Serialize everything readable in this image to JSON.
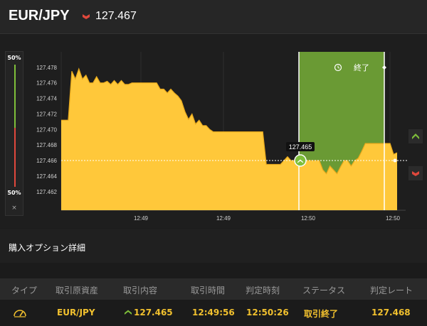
{
  "header": {
    "pair": "EUR/JPY",
    "rate": "127.467",
    "direction_icon": "down-arrow-icon",
    "down_color": "#e0483c"
  },
  "ratio": {
    "top": "50%",
    "bottom": "50%",
    "close": "×"
  },
  "chart_data": {
    "type": "area",
    "ylim": [
      127.4596,
      127.48
    ],
    "y_ticks": [
      127.478,
      127.476,
      127.474,
      127.472,
      127.47,
      127.468,
      127.466,
      127.464,
      127.462
    ],
    "y_tick_labels": [
      "127.478",
      "127.476",
      "127.474",
      "127.472",
      "127.470",
      "127.468",
      "127.466",
      "127.464",
      "127.462"
    ],
    "x_ticks": [
      "12:49",
      "12:49",
      "12:50",
      "12:50"
    ],
    "series": [
      {
        "values": [
          127.4712,
          127.4712,
          127.4712,
          127.4775,
          127.4765,
          127.4778,
          127.4765,
          127.477,
          127.476,
          127.476,
          127.4768,
          127.476,
          127.476,
          127.4762,
          127.4758,
          127.4763,
          127.4758,
          127.4763,
          127.4758,
          127.4758,
          127.476,
          127.476,
          127.476,
          127.476,
          127.476,
          127.476,
          127.476,
          127.476,
          127.4752,
          127.4752,
          127.4747,
          127.4752,
          127.4747,
          127.4743,
          127.4737,
          127.4723,
          127.4713,
          127.472,
          127.4707,
          127.4712,
          127.4705,
          127.4705,
          127.47,
          127.4697,
          127.4697,
          127.4697,
          127.4697,
          127.4697,
          127.4697,
          127.4697,
          127.4697,
          127.4697,
          127.4697,
          127.4697,
          127.4697,
          127.4697,
          127.4697,
          127.4697,
          127.4655,
          127.4655,
          127.4655,
          127.4655,
          127.4655,
          127.466,
          127.4665,
          127.466,
          127.466,
          127.466,
          127.466,
          127.466,
          127.466,
          127.466,
          127.466,
          127.466,
          127.4648,
          127.4643,
          127.4653,
          127.4648,
          127.4643,
          127.4652,
          127.466,
          127.466,
          127.4653,
          127.466,
          127.4663,
          127.4672,
          127.4682,
          127.4682,
          127.4682,
          127.4682,
          127.4682,
          127.4682,
          127.4682,
          127.4682,
          127.4668,
          127.467
        ]
      }
    ],
    "current_price_label": "127.465",
    "current_price": 127.4655,
    "end_price": 127.467,
    "expiry_label": "終了",
    "line_color": "#e8a91c",
    "fill_color": "#ffc83a",
    "expiry_zone_color": "#6a9a34",
    "up_color": "#7fbf3a"
  },
  "section": {
    "title": "購入オプション詳細"
  },
  "table": {
    "headers": [
      "タイプ",
      "取引原資産",
      "取引内容",
      "取引時間",
      "判定時刻",
      "ステータス",
      "判定レート"
    ],
    "row": {
      "type_icon": "gauge-icon",
      "asset": "EUR/JPY",
      "direction_icon": "up-arrow-icon",
      "content": "127.465",
      "trade_time": "12:49:56",
      "judge_time": "12:50:26",
      "status": "取引終了",
      "judge_rate": "127.468"
    }
  }
}
